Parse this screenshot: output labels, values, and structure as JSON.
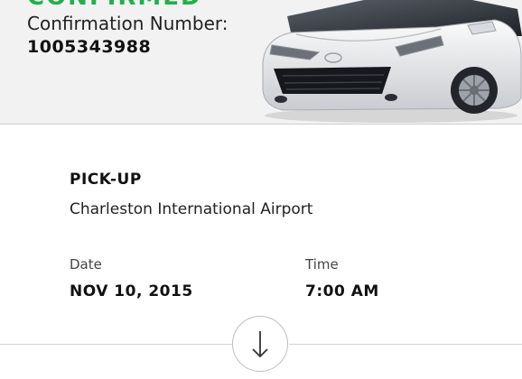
{
  "header": {
    "status": "CONFIRMED",
    "confirmation_label": "Confirmation Number:",
    "confirmation_number": "1005343988",
    "accent_color": "#1fb04b"
  },
  "pickup": {
    "heading": "PICK-UP",
    "location": "Charleston International Airport",
    "date_label": "Date",
    "date_value": "NOV 10, 2015",
    "time_label": "Time",
    "time_value": "7:00 AM"
  },
  "icons": {
    "expand": "arrow-down-icon",
    "car": "car-image"
  }
}
